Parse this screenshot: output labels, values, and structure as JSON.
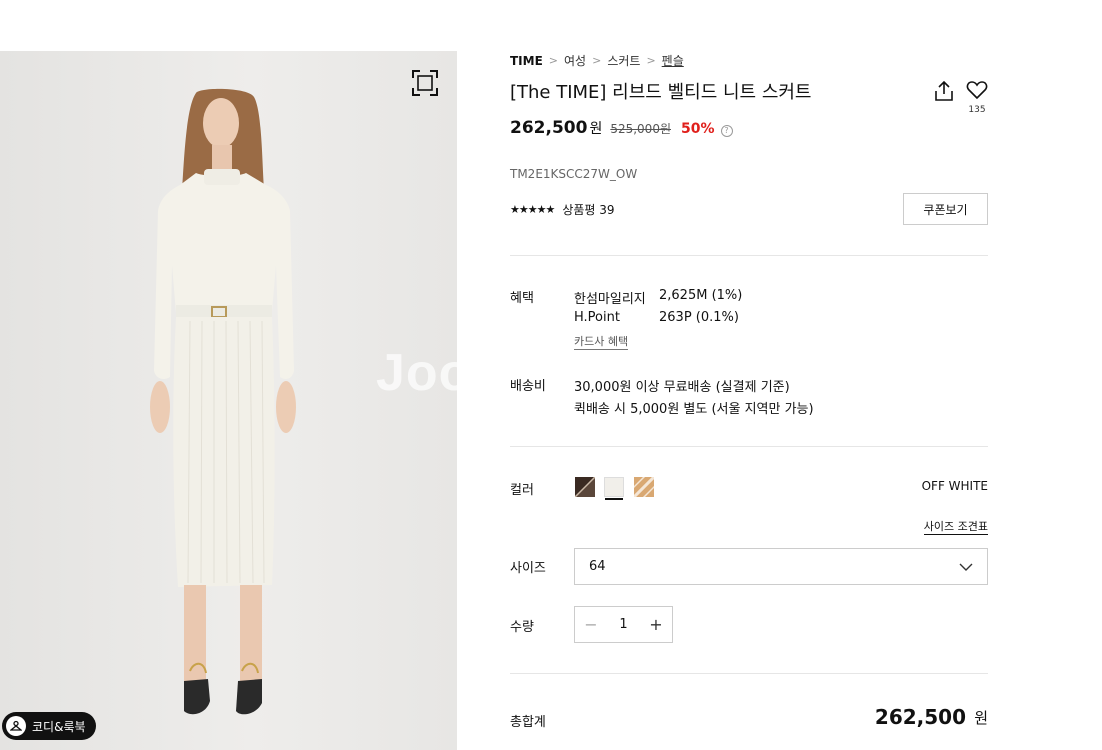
{
  "gallery": {
    "watermark": "Joo",
    "coordi_label": "코디&룩북"
  },
  "breadcrumb": [
    "TIME",
    "여성",
    "스커트",
    "펜슬"
  ],
  "product": {
    "title": "[The TIME] 리브드 벨티드 니트 스커트",
    "like_count": "135",
    "price": "262,500",
    "price_unit": "원",
    "original_price": "525,000원",
    "discount": "50%",
    "sku": "TM2E1KSCC27W_OW",
    "review_label": "상품평 39",
    "rating": 5
  },
  "coupon_button": "쿠폰보기",
  "benefits": {
    "label": "혜택",
    "items": [
      {
        "name": "한섬마일리지",
        "value": "2,625M (1%)"
      },
      {
        "name": "H.Point",
        "value": "263P (0.1%)"
      }
    ],
    "card_link": "카드사 혜택"
  },
  "shipping": {
    "label": "배송비",
    "lines": [
      "30,000원 이상 무료배송 (실결제 기준)",
      "퀵배송 시 5,000원 별도 (서울 지역만 가능)"
    ]
  },
  "color": {
    "label": "컬러",
    "selected_name": "OFF WHITE",
    "swatches": [
      {
        "name": "dark brown",
        "colors": [
          "#3a2a22",
          "#8a7a6e"
        ]
      },
      {
        "name": "off white",
        "colors": [
          "#f1efea",
          "#f1efea"
        ]
      },
      {
        "name": "camel",
        "colors": [
          "#d9a872",
          "#f4e6d6"
        ]
      }
    ]
  },
  "size_guide": "사이즈 조견표",
  "size": {
    "label": "사이즈",
    "value": "64"
  },
  "quantity": {
    "label": "수량",
    "value": "1"
  },
  "total": {
    "label": "총합계",
    "price": "262,500",
    "unit": "원"
  },
  "colors": {
    "discount": "#e0201c",
    "text": "#111111",
    "border": "#cccccc"
  }
}
